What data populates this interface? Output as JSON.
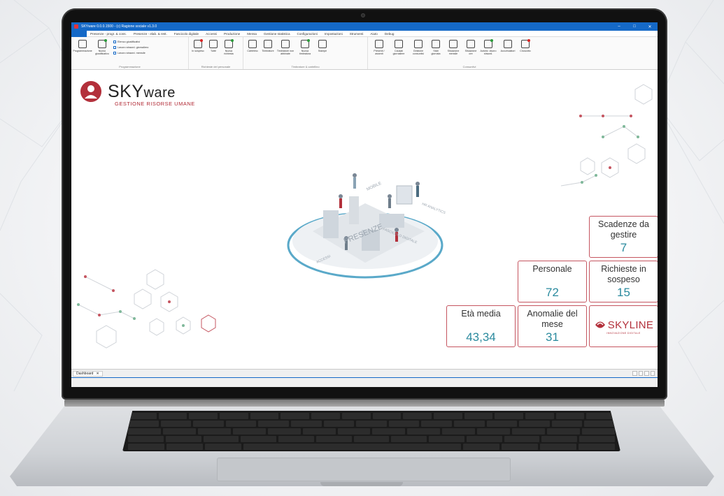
{
  "window": {
    "title": "SKYware 0.0.0.1500 - (c) Ragione sociale v1.3.0",
    "controls": [
      "–",
      "□",
      "✕"
    ]
  },
  "menu": [
    "",
    "Presenze - progr. & cons.",
    "Presenze - elab. & rest.",
    "Fascicolo digitale",
    "Accessi",
    "Produzione",
    "Mensa",
    "Gestione statistica",
    "Configurazioni",
    "Impostazioni",
    "Strumenti",
    "Aiuto",
    "Debug"
  ],
  "ribbon": {
    "groups": [
      {
        "name": "Programmazione",
        "buttons": [
          "Programmazione",
          "Nuovo giustificativo"
        ],
        "small": [
          "Elenco giustificativi",
          "Lavoro straord. giornaliero",
          "Lavoro straord. mensile"
        ]
      },
      {
        "name": "Richieste del personale",
        "buttons": [
          "In sospeso",
          "Tutte",
          "Nuova richiesta"
        ]
      },
      {
        "name": "Timbrature & cartellino",
        "buttons": [
          "Cartellino",
          "Timbrature",
          "Timbrature non abbinate",
          "Nuova timbratura",
          "Stampe"
        ]
      },
      {
        "name": "Consuntivi",
        "buttons": [
          "Presenti / assenti",
          "Causali giornaliere",
          "Gestione consuntivi",
          "Stati giornata",
          "Situazione mensile",
          "Situazione ore",
          "Autoriz. lavoro straord.",
          "Accumulatori",
          "Cruscotto"
        ]
      }
    ]
  },
  "logo": {
    "sky": "SKY",
    "ware": "ware",
    "subtitle": "GESTIONE RISORSE UMANE"
  },
  "illustration": {
    "labels": [
      "PRESENZE",
      "MOBILE",
      "FASCICOLO DIGITALE",
      "HR ANALYTICS",
      "ACCESSI"
    ]
  },
  "dashboard": {
    "scadenze": {
      "label": "Scadenze da gestire",
      "value": "7"
    },
    "personale": {
      "label": "Personale",
      "value": "72"
    },
    "richieste": {
      "label": "Richieste in sospeso",
      "value": "15"
    },
    "eta": {
      "label": "Età media",
      "value": "43,34"
    },
    "anomalie": {
      "label": "Anomalie del mese",
      "value": "31"
    },
    "brand": {
      "name": "SKYLINE",
      "tagline": "INNOVAZIONE DIGITALE"
    }
  },
  "tabs": [
    {
      "label": "Dashboard",
      "close": "✕"
    }
  ],
  "colors": {
    "accent": "#1569c7",
    "brand_red": "#b3303b",
    "tile_border": "#c55560",
    "value_teal": "#2a8a9e"
  }
}
